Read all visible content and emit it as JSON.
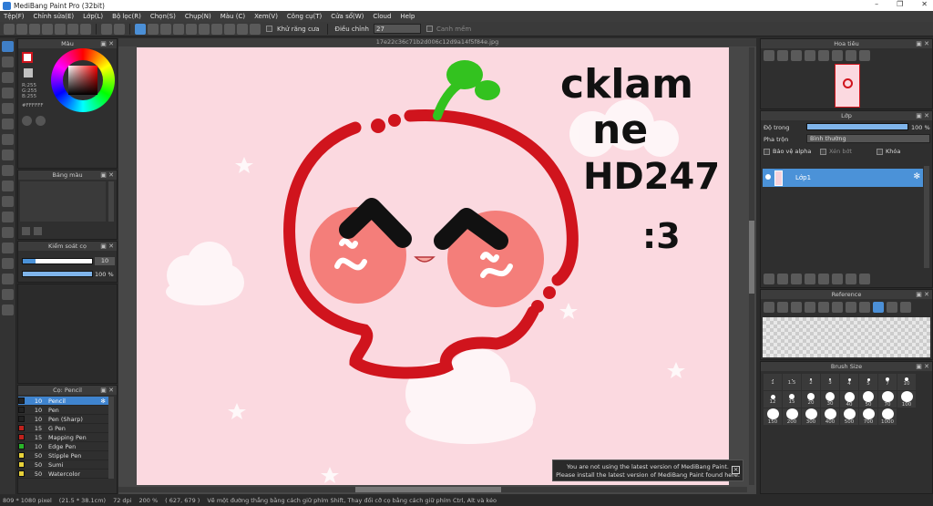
{
  "window": {
    "title": "MediBang Paint Pro (32bit)",
    "controls": [
      "–",
      "❐",
      "✕"
    ]
  },
  "menu": [
    "Tệp(F)",
    "Chỉnh sửa(E)",
    "Lớp(L)",
    "Bộ lọc(R)",
    "Chọn(S)",
    "Chụp(N)",
    "Màu (C)",
    "Xem(V)",
    "Công cụ(T)",
    "Cửa sổ(W)",
    "Cloud",
    "Help"
  ],
  "toolbar": {
    "antialias_label": "Khử răng cưa",
    "correction_label": "Điều chỉnh",
    "correction_value": "27",
    "smooth_label": "Canh mềm"
  },
  "file_tab": "17e22c36c71b2d006c12d9a14f5f84e.jpg",
  "color_panel": {
    "title": "Màu",
    "r": "R:255",
    "g": "G:255",
    "b": "B:255",
    "hex": "#FFFFFF"
  },
  "palette_panel": {
    "title": "Bảng màu"
  },
  "brush_control": {
    "title": "Kiểm soát cọ",
    "size_value": "10",
    "opacity_value": "100 %"
  },
  "brush_list": {
    "title": "Cọ: Pencil",
    "items": [
      {
        "size": "10",
        "name": "Pencil",
        "color": "#222222"
      },
      {
        "size": "10",
        "name": "Pen",
        "color": "#222222"
      },
      {
        "size": "10",
        "name": "Pen (Sharp)",
        "color": "#222222"
      },
      {
        "size": "15",
        "name": "G Pen",
        "color": "#c0221d"
      },
      {
        "size": "15",
        "name": "Mapping Pen",
        "color": "#c0221d"
      },
      {
        "size": "10",
        "name": "Edge Pen",
        "color": "#2ab52a"
      },
      {
        "size": "50",
        "name": "Stipple Pen",
        "color": "#e8d23a"
      },
      {
        "size": "50",
        "name": "Sumi",
        "color": "#e8d23a"
      },
      {
        "size": "50",
        "name": "Watercolor",
        "color": "#e8d23a"
      }
    ]
  },
  "navigator": {
    "title": "Hoa tiêu"
  },
  "layers": {
    "title": "Lớp",
    "opacity_label": "Độ trong",
    "opacity_value": "100 %",
    "blend_label": "Pha trộn",
    "blend_value": "Bình thường",
    "protect_alpha": "Bảo vệ alpha",
    "clipping": "Xén bớt",
    "lock": "Khóa",
    "layer_name": "Lớp1"
  },
  "reference": {
    "title": "Reference"
  },
  "brush_size": {
    "title": "Brush Size",
    "sizes": [
      "1",
      "1.5",
      "2",
      "3",
      "4",
      "5",
      "7",
      "10",
      "12",
      "15",
      "20",
      "30",
      "40",
      "50",
      "70",
      "100",
      "150",
      "200",
      "300",
      "400",
      "500",
      "700",
      "1000"
    ]
  },
  "artwork_text": {
    "line1": "cklam",
    "line2": "ne",
    "line3": "HD247",
    "line4": ":3"
  },
  "notification": {
    "line1": "You are not using the latest version of MediBang Paint.",
    "line2": "Please install the latest version of MediBang Paint found here."
  },
  "status": {
    "dimensions": "809 * 1080 pixel",
    "physical": "(21.5 * 38.1cm)",
    "dpi": "72 dpi",
    "zoom": "200 %",
    "coords": "( 627, 679 )",
    "hint": "Vẽ một đường thẳng bằng cách giữ phím Shift, Thay đổi cỡ cọ bằng cách giữ phím Ctrl, Alt và kéo"
  },
  "colors": {
    "accent": "#4b92d8",
    "canvas_pink": "#fbd9e0",
    "outline_red": "#d0141d",
    "cheek": "#f47e7a",
    "sprout": "#33c21f"
  }
}
